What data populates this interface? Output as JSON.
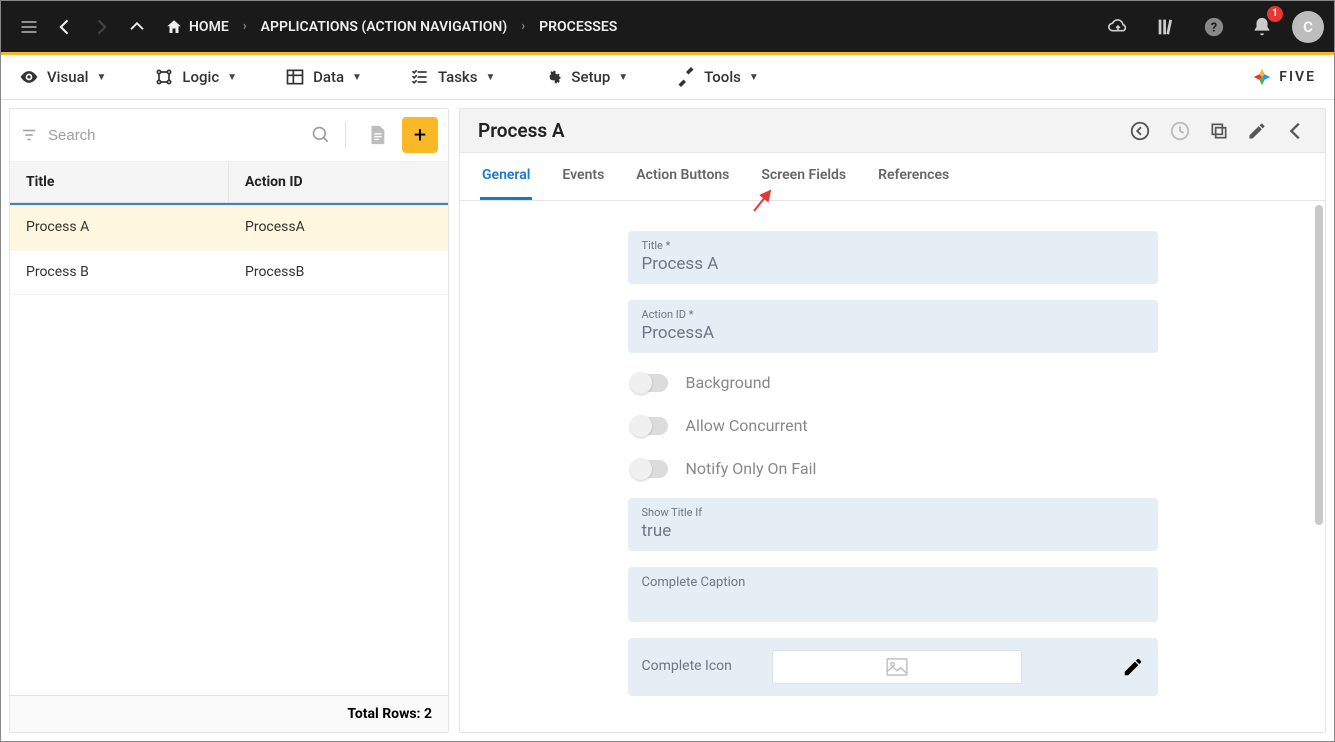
{
  "topbar": {
    "breadcrumbs": [
      {
        "label": "HOME",
        "has_home_icon": true
      },
      {
        "label": "APPLICATIONS (ACTION NAVIGATION)"
      },
      {
        "label": "PROCESSES"
      }
    ],
    "notification_count": "1",
    "avatar_initial": "C"
  },
  "menubar": {
    "items": [
      {
        "label": "Visual"
      },
      {
        "label": "Logic"
      },
      {
        "label": "Data"
      },
      {
        "label": "Tasks"
      },
      {
        "label": "Setup"
      },
      {
        "label": "Tools"
      }
    ],
    "brand": "FIVE"
  },
  "list": {
    "search_placeholder": "Search",
    "columns": [
      "Title",
      "Action ID"
    ],
    "rows": [
      {
        "title": "Process A",
        "action_id": "ProcessA",
        "selected": true
      },
      {
        "title": "Process B",
        "action_id": "ProcessB",
        "selected": false
      }
    ],
    "footer": "Total Rows: 2"
  },
  "detail": {
    "title": "Process A",
    "tabs": [
      "General",
      "Events",
      "Action Buttons",
      "Screen Fields",
      "References"
    ],
    "active_tab": "General",
    "fields": {
      "title_label": "Title *",
      "title_value": "Process A",
      "action_id_label": "Action ID *",
      "action_id_value": "ProcessA",
      "background_label": "Background",
      "allow_concurrent_label": "Allow Concurrent",
      "notify_only_on_fail_label": "Notify Only On Fail",
      "show_title_if_label": "Show Title If",
      "show_title_if_value": "true",
      "complete_caption_label": "Complete Caption",
      "complete_caption_value": "",
      "complete_icon_label": "Complete Icon"
    }
  }
}
